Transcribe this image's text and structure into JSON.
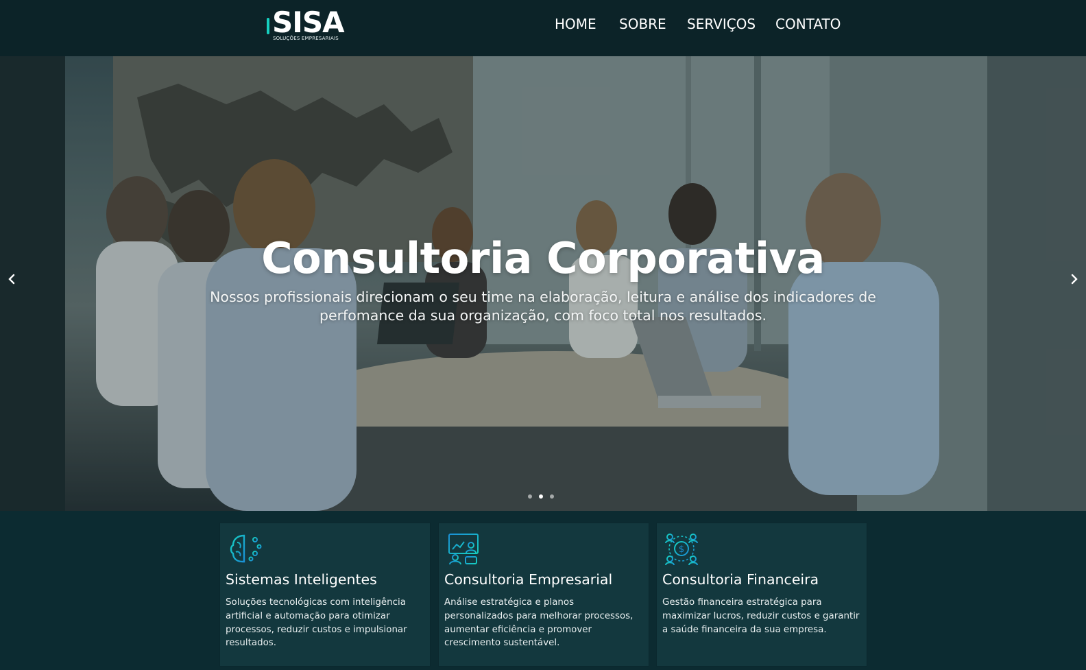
{
  "header": {
    "logo": {
      "word": "SISA",
      "subtitle": "SOLUÇÕES EMPRESARIAIS"
    },
    "nav": [
      {
        "label": "HOME"
      },
      {
        "label": "SOBRE"
      },
      {
        "label": "SERVIÇOS"
      },
      {
        "label": "CONTATO"
      }
    ]
  },
  "hero": {
    "title": "Consultoria Corporativa",
    "subtitle": "Nossos profissionais direcionam o seu time na elaboração, leitura e análise dos indicadores de perfomance da sua organização, com foco total nos resultados.",
    "prev_icon": "chevron-left-icon",
    "next_icon": "chevron-right-icon",
    "slide_count": 3,
    "active_slide": 2
  },
  "services": [
    {
      "icon": "brain-circuit-icon",
      "title": "Sistemas Inteligentes",
      "text": "Soluções tecnológicas com inteligência artificial e automação para otimizar processos, reduzir custos e impulsionar resultados."
    },
    {
      "icon": "consulting-meeting-icon",
      "title": "Consultoria Empresarial",
      "text": "Análise estratégica e planos personalizados para melhorar processos, aumentar eficiência e promover crescimento sustentável."
    },
    {
      "icon": "money-network-icon",
      "title": "Consultoria Financeira",
      "text": "Gestão financeira estratégica para maximizar lucros, reduzir custos e garantir a saúde financeira da sua empresa."
    }
  ],
  "colors": {
    "header_bg": "#0c2328",
    "page_bg": "#0c2b31",
    "card_bg": "#13383e",
    "accent_teal": "#16d0c0",
    "icon_blue": "#1a8fd6"
  }
}
